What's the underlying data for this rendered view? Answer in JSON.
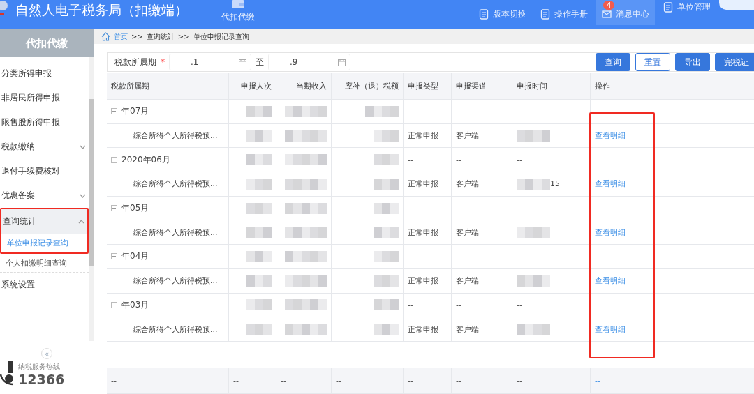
{
  "header": {
    "title": "自然人电子税务局（扣缴端）",
    "nav": [
      {
        "label": "代扣代缴",
        "selected": true
      }
    ],
    "tools": [
      {
        "label": "版本切换",
        "selected": false
      },
      {
        "label": "操作手册",
        "selected": false
      },
      {
        "label": "消息中心",
        "badge": "4",
        "selected": true
      },
      {
        "label": "单位管理",
        "selected": false
      }
    ]
  },
  "sidebar": {
    "title": "代扣代缴",
    "items": [
      {
        "label": "分类所得申报",
        "expandable": false,
        "expanded": false,
        "highlighted": false
      },
      {
        "label": "非居民所得申报",
        "expandable": false,
        "expanded": false,
        "highlighted": false
      },
      {
        "label": "限售股所得申报",
        "expandable": false,
        "expanded": false,
        "highlighted": false
      },
      {
        "label": "税款缴纳",
        "expandable": true,
        "expanded": false,
        "highlighted": false
      },
      {
        "label": "退付手续费核对",
        "expandable": false,
        "expanded": false,
        "highlighted": false
      },
      {
        "label": "优惠备案",
        "expandable": true,
        "expanded": false,
        "highlighted": false
      },
      {
        "label": "查询统计",
        "expandable": true,
        "expanded": true,
        "highlighted": true,
        "children": [
          {
            "label": "单位申报记录查询",
            "selected": true
          },
          {
            "label": "个人扣缴明细查询",
            "selected": false
          }
        ]
      },
      {
        "label": "系统设置",
        "expandable": false,
        "expanded": false,
        "highlighted": false
      }
    ],
    "collapse": "«",
    "hotline_label": "纳税服务热线",
    "hotline": "12366"
  },
  "breadcrumb": [
    "首页",
    "查询统计",
    "单位申报记录查询"
  ],
  "breadcrumb_sep": ">>",
  "filter": {
    "label": "税款所属期",
    "required": "*",
    "from": ".1",
    "to_label": "至",
    "to": ".9",
    "buttons": [
      {
        "label": "查询",
        "kind": "primary"
      },
      {
        "label": "重置",
        "kind": "outline"
      },
      {
        "label": "导出",
        "kind": "primary"
      },
      {
        "label": "完税证",
        "kind": "primary"
      }
    ]
  },
  "table": {
    "columns": [
      "税款所属期",
      "申报人次",
      "当期收入",
      "应补（退）税额",
      "申报类型",
      "申报渠道",
      "申报时间",
      "操作"
    ],
    "action_column_highlighted": true,
    "rows": [
      {
        "kind": "month",
        "period": "年07月",
        "type": "--",
        "channel": "--",
        "time": "--"
      },
      {
        "kind": "record",
        "period": "综合所得个人所得税预...",
        "type": "正常申报",
        "channel": "客户端",
        "action": "查看明细"
      },
      {
        "kind": "month",
        "period": "2020年06月",
        "type": "--",
        "channel": "--",
        "time": "--"
      },
      {
        "kind": "record",
        "period": "综合所得个人所得税预...",
        "type": "正常申报",
        "channel": "客户端",
        "time": "15",
        "action": "查看明细"
      },
      {
        "kind": "month",
        "period": "年05月",
        "type": "--",
        "channel": "--",
        "time": "--"
      },
      {
        "kind": "record",
        "period": "综合所得个人所得税预...",
        "type": "正常申报",
        "channel": "客户端",
        "action": "查看明细"
      },
      {
        "kind": "month",
        "period": "年04月",
        "type": "--",
        "channel": "--",
        "time": "--"
      },
      {
        "kind": "record",
        "period": "综合所得个人所得税预...",
        "type": "正常申报",
        "channel": "客户端",
        "action": "查看明细"
      },
      {
        "kind": "month",
        "period": "年03月",
        "type": "--",
        "channel": "--",
        "time": "--"
      },
      {
        "kind": "record",
        "period": "综合所得个人所得税预...",
        "type": "正常申报",
        "channel": "客户端",
        "action": "查看明细"
      }
    ],
    "footer": [
      "--",
      "--",
      "--",
      "--",
      "--",
      "--",
      "--",
      "--"
    ]
  }
}
